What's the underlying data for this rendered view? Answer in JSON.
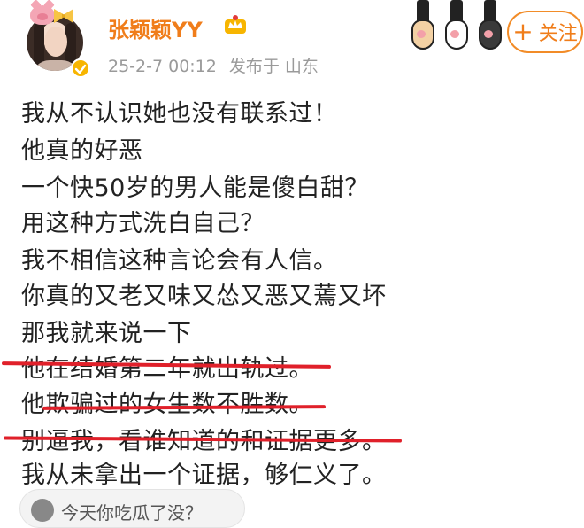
{
  "user": {
    "name": "张颖颖YY",
    "post_time": "25-2-7 00:12",
    "location_label": "发布于 山东"
  },
  "actions": {
    "follow_label": "关注"
  },
  "post": {
    "lines": [
      "我从不认识她也没有联系过！",
      "他真的好恶",
      "一个快50岁的男人能是傻白甜？",
      "用这种方式洗白自己？",
      "我不相信这种言论会有人信。",
      "你真的又老又味又怂又恶又蔫又坏",
      "那我就来说一下",
      "他在结婚第二年就出轨过。",
      "他欺骗过的女生数不胜数。",
      "别逼我，看谁知道的和证据更多。",
      "我从未拿出一个证据，够仁义了。"
    ]
  },
  "comment": {
    "prompt": "今天你吃瓜了没？"
  },
  "colors": {
    "accent": "#f07d1a",
    "underline": "#e0202a"
  },
  "icons": [
    "pig-badge-icon",
    "bow-badge-icon",
    "verified-badge-icon",
    "crown-icon",
    "cat-paw-icon",
    "plus-icon",
    "melon-icon"
  ]
}
